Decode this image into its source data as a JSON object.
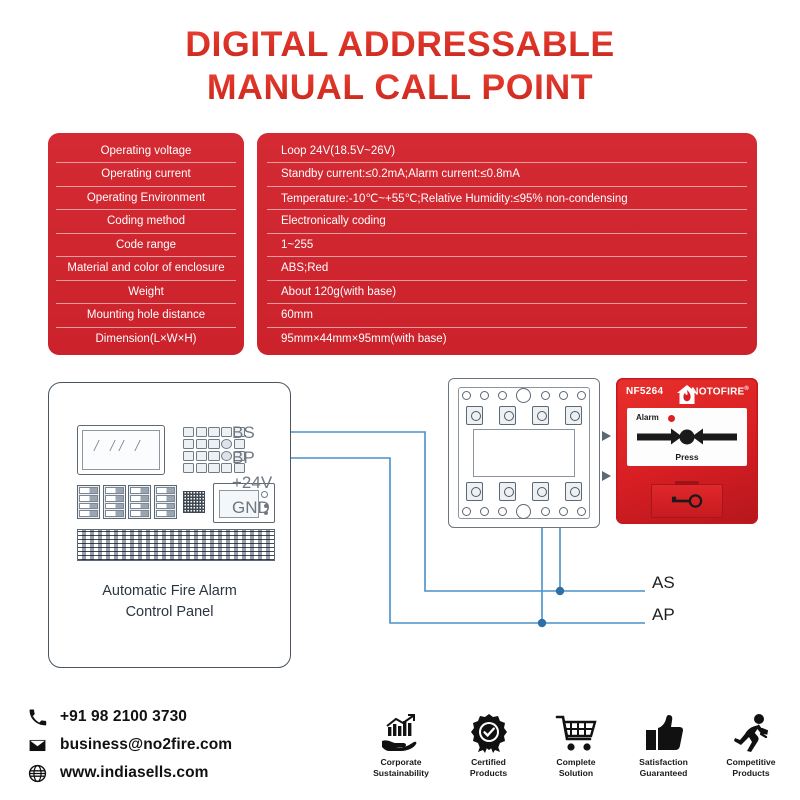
{
  "title": {
    "line1": "DIGITAL ADDRESSABLE",
    "line2": "MANUAL CALL POINT",
    "color": "#DC3226"
  },
  "spec_table": {
    "panel_color": "#D22630",
    "rows": [
      {
        "label": "Operating voltage",
        "value": "Loop 24V(18.5V~26V)"
      },
      {
        "label": "Operating current",
        "value": "Standby current:≤0.2mA;Alarm current:≤0.8mA"
      },
      {
        "label": "Operating Environment",
        "value": "Temperature:-10℃~+55℃;Relative Humidity:≤95% non-condensing"
      },
      {
        "label": "Coding method",
        "value": "Electronically coding"
      },
      {
        "label": "Code range",
        "value": "1~255"
      },
      {
        "label": "Material and color of enclosure",
        "value": "ABS;Red"
      },
      {
        "label": "Weight",
        "value": "About 120g(with base)"
      },
      {
        "label": "Mounting hole distance",
        "value": "60mm"
      },
      {
        "label": "Dimension(L×W×H)",
        "value": "95mm×44mm×95mm(with base)"
      }
    ]
  },
  "diagram": {
    "control_panel": {
      "caption_line1": "Automatic Fire Alarm",
      "caption_line2": "Control Panel",
      "terminals": [
        "BS",
        "BP",
        "+24V",
        "GND"
      ]
    },
    "call_point": {
      "model": "NF5264",
      "brand": "NOTOFIRE",
      "brand_mark": "®",
      "alarm_label": "Alarm",
      "press_label": "Press",
      "led_color": "#E02020",
      "body_color": "#D71E23"
    },
    "wire_labels": [
      "AS",
      "AP"
    ],
    "wire_color": "#4A90C8"
  },
  "contact": {
    "phone": "+91 98 2100 3730",
    "email": "business@no2fire.com",
    "website": "www.indiasells.com"
  },
  "badges": [
    {
      "icon": "growth-hand-icon",
      "line1": "Corporate",
      "line2": "Sustainability"
    },
    {
      "icon": "certified-seal-icon",
      "line1": "Certified",
      "line2": "Products"
    },
    {
      "icon": "shopping-cart-icon",
      "line1": "Complete",
      "line2": "Solution"
    },
    {
      "icon": "thumbs-up-icon",
      "line1": "Satisfaction",
      "line2": "Guaranteed"
    },
    {
      "icon": "running-man-icon",
      "line1": "Competitive",
      "line2": "Products"
    }
  ]
}
